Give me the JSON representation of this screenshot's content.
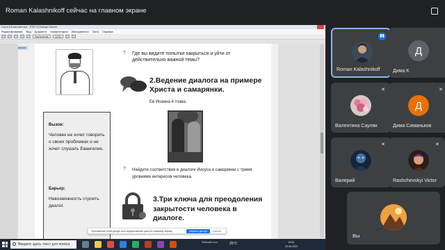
{
  "presenter": {
    "title": "Roman Kalashnikoff сейчас на главном экране"
  },
  "viewer": {
    "title": "Сила в Благовестии - PDF-XChange Viewer",
    "menu": [
      "Редактирование",
      "Вид",
      "Документ",
      "Комментарии",
      "Инструменты",
      "Окно",
      "Справка"
    ],
    "zoom": "110%",
    "tab": "Сила в Благовестии",
    "view_mode": "Увеличение"
  },
  "document": {
    "question1": "Где вы видите попытки закрыться и уйти от действительно важной темы?",
    "heading1": "2.Ведение диалога на примере Христа и самарянки.",
    "caption1": "Ев Иоанна 4 глава.",
    "call_heading": "Вызов:",
    "call_text": "Человек не хочет говорить о своих проблемах и не хочет слушать Евангелие.",
    "barrier_heading": "Барьер:",
    "barrier_text": "Невозможность строить диалог.",
    "question2": "Найдите соответствия в диалоге Иисуса и самарянки с тремя уровнями интересов человека.",
    "heading2": "3.Три ключа для преодоления закрытости человека в диалоге."
  },
  "notice": {
    "text": "Приложение meet.google.com предоставляет доступ к вашему экрану.",
    "stop_label": "Закрыть доступ",
    "hide_label": "Скрыть"
  },
  "taskbar": {
    "search_placeholder": "Введите здесь текст для поиска",
    "weather": "Рабочий стол",
    "temperature": "25°C",
    "time": "19:41",
    "date": "03.06.2021"
  },
  "participants": [
    {
      "name": "Roman Kalashnikoff",
      "avatar": "photo",
      "mic": "on"
    },
    {
      "name": "Дима К",
      "avatar": "letter",
      "letter": "Д",
      "color": "#5f6368",
      "mic": ""
    },
    {
      "name": "Валентина Сауляк",
      "avatar": "photo",
      "mic": "muted"
    },
    {
      "name": "Дима Симаньков",
      "avatar": "letter",
      "letter": "Д",
      "color": "#e8710a",
      "mic": "muted"
    },
    {
      "name": "Валерий",
      "avatar": "photo",
      "mic": "muted"
    },
    {
      "name": "Rashchevskyi Victor",
      "avatar": "photo",
      "mic": "muted"
    },
    {
      "name": "Вы",
      "avatar": "photo",
      "mic": ""
    }
  ],
  "colors": {
    "background": "#202124",
    "tile": "#3c4043",
    "accent": "#8ab4f8",
    "mic_active": "#1a73e8"
  }
}
